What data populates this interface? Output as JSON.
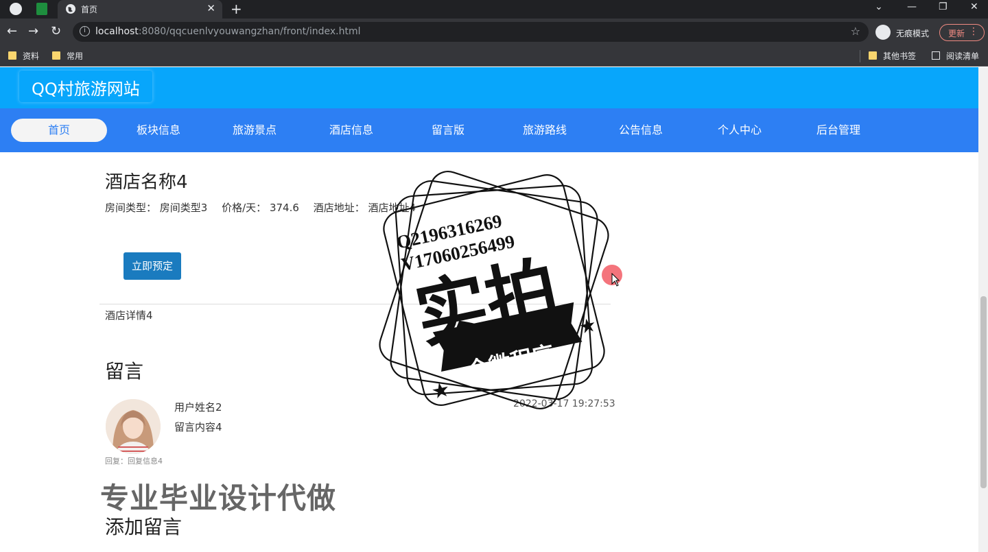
{
  "browser": {
    "tab_title": "首页",
    "url_host": "localhost",
    "url_rest": ":8080/qqcuenlvyouwangzhan/front/index.html",
    "incognito_label": "无痕模式",
    "update_label": "更新",
    "bookmarks": [
      {
        "label": "资料"
      },
      {
        "label": "常用"
      }
    ],
    "other_bookmarks": "其他书签",
    "reading_list": "阅读清单"
  },
  "site": {
    "title": "QQ村旅游网站",
    "nav": [
      {
        "label": "首页",
        "active": true
      },
      {
        "label": "板块信息"
      },
      {
        "label": "旅游景点"
      },
      {
        "label": "酒店信息"
      },
      {
        "label": "留言版"
      },
      {
        "label": "旅游路线"
      },
      {
        "label": "公告信息"
      },
      {
        "label": "个人中心"
      },
      {
        "label": "后台管理"
      }
    ]
  },
  "hotel": {
    "name": "酒店名称4",
    "room_type_label": "房间类型：",
    "room_type": "房间类型3",
    "price_label": "价格/天：",
    "price": "374.6",
    "address_label": "酒店地址：",
    "address": "酒店地址4",
    "book_button": "立即预定",
    "detail": "酒店详情4"
  },
  "comments": {
    "title": "留言",
    "items": [
      {
        "user": "用户姓名2",
        "content": "留言内容4",
        "time": "2022-03-17 19:27:53",
        "reply": "回复：回复信息4"
      }
    ],
    "add_title": "添加留言"
  },
  "overlay": {
    "phone_q": "Q2196316269",
    "phone_v": "V17060256499",
    "stamp_main": "实拍",
    "stamp_banner": "全微程序",
    "ad_text": "专业毕业设计代做"
  },
  "colors": {
    "header_bg": "#08a6fb",
    "nav_bg": "#2d7ff3",
    "button_bg": "#1a7bbf"
  }
}
